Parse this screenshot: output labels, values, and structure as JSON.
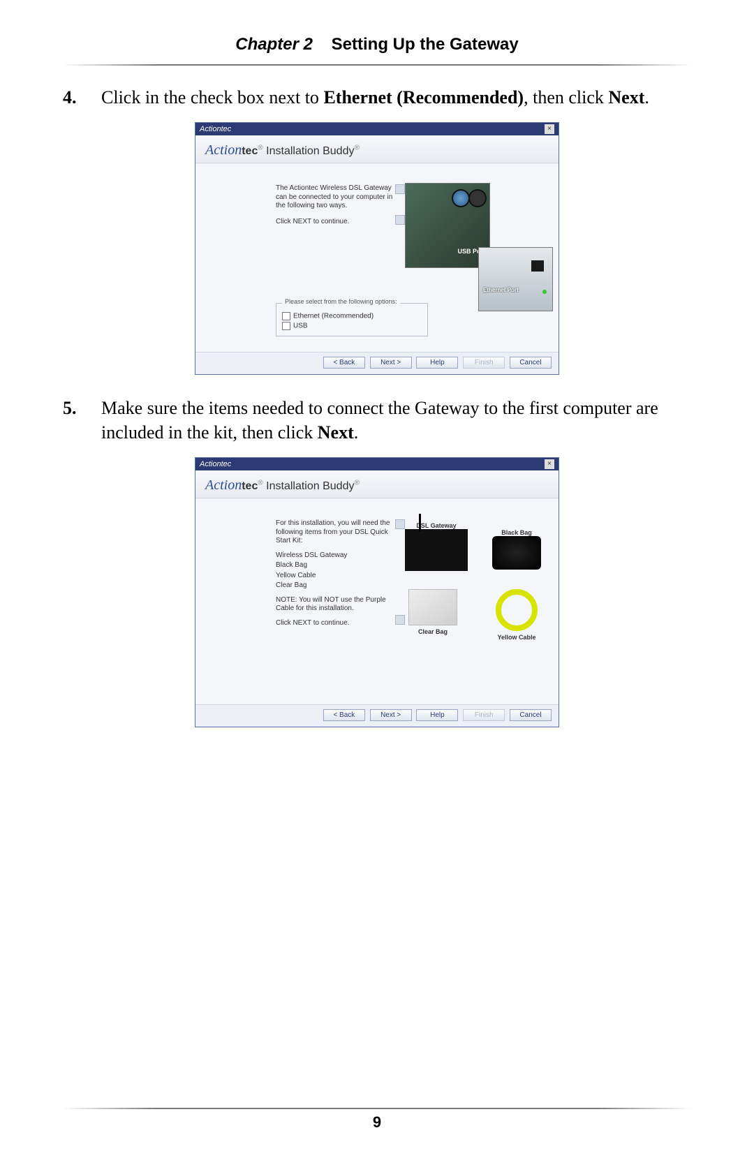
{
  "header": {
    "chapter": "Chapter 2",
    "title": "Setting Up the Gateway"
  },
  "page_number": "9",
  "steps": {
    "s4": {
      "num": "4.",
      "pre": "Click in the check box next to ",
      "b1": "Ethernet (Recommended)",
      "mid": ", then click ",
      "b2": "Next",
      "post": "."
    },
    "s5": {
      "num": "5.",
      "pre": "Make sure the items needed to connect the Gateway to the first computer are included in the kit, then click ",
      "b1": "Next",
      "post": "."
    }
  },
  "dialog_common": {
    "title": "Actiontec",
    "close": "×",
    "brand_prefix": "Action",
    "brand_suffix": "tec",
    "reg": "®",
    "product": " Installation Buddy",
    "buttons": {
      "back": "< Back",
      "next": "Next >",
      "help": "Help",
      "finish": "Finish",
      "cancel": "Cancel"
    }
  },
  "dialog1": {
    "para1": "The Actiontec Wireless DSL Gateway can be connected to your computer in the following two ways.",
    "para2": "Click NEXT to continue.",
    "usb_label": "USB Port",
    "eth_label": "Ethernet Port",
    "legend": "Please select from the following options:",
    "opt1": "Ethernet (Recommended)",
    "opt2": "USB"
  },
  "dialog2": {
    "para1": "For this installation, you will need the following items from your DSL Quick Start Kit:",
    "list1": "Wireless DSL Gateway",
    "list2": "Black Bag",
    "list3": "Yellow Cable",
    "list4": "Clear Bag",
    "note": "NOTE: You will NOT use the Purple Cable for this installation.",
    "para2": "Click NEXT to continue.",
    "lbl_gateway": "DSL Gateway",
    "lbl_blackbag": "Black Bag",
    "lbl_clearbag": "Clear Bag",
    "lbl_yellow": "Yellow Cable"
  }
}
